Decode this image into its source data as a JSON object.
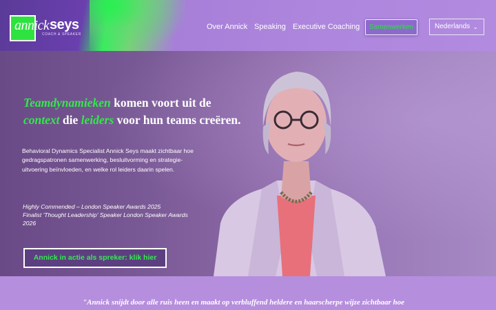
{
  "brand": {
    "logo_first": "annick",
    "logo_second": "seys",
    "logo_tagline": "COACH & SPEAKER"
  },
  "nav": {
    "items": [
      {
        "label": "Over Annick"
      },
      {
        "label": "Speaking"
      },
      {
        "label": "Executive Coaching"
      }
    ],
    "cta_label": "Samenwerken",
    "language": {
      "selected": "Nederlands",
      "icon": "chevron-down-icon"
    }
  },
  "hero": {
    "headline": {
      "part1_green": "Teamdynamieken",
      "part2": " komen voort uit de",
      "part3_green": "context",
      "part4": " die ",
      "part5_green": "leiders",
      "part6": " voor hun teams creëren."
    },
    "intro": "Behavioral Dynamics Specialist Annick Seys maakt zichtbaar hoe gedragspatronen samenwerking, besluitvorming en strategie-uitvoering beïnvloeden, en welke rol leiders daarin spelen.",
    "awards": [
      "Highly Commended – London Speaker Awards 2025",
      "Finalist 'Thought Leadership' Speaker London Speaker Awards 2026"
    ],
    "button_label": "Annick in actie als spreker: klik hier"
  },
  "quote": {
    "text": "\"Annick snijdt door alle ruis heen en maakt op verbluffend heldere en haarscherpe wijze zichtbaar hoe"
  },
  "colors": {
    "accent_green": "#32e84a",
    "header_purple": "#a77fd8",
    "band_purple": "#b68ede"
  }
}
